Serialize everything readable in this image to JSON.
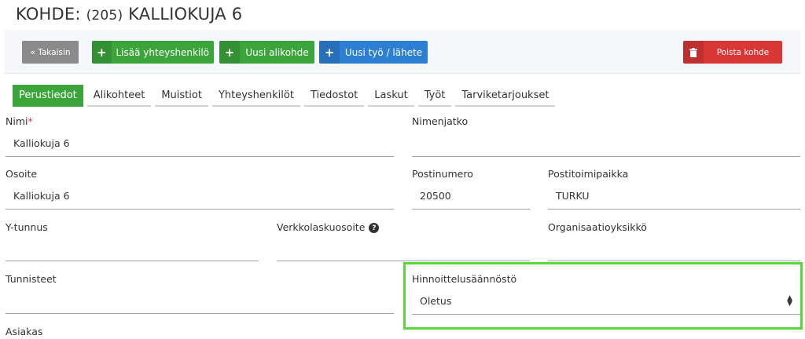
{
  "header": {
    "title_prefix": "KOHDE:",
    "title_code": "(205)",
    "title_name": "KALLIOKUJA 6"
  },
  "toolbar": {
    "back_label": "Takaisin",
    "add_contact_label": "Lisää yhteyshenkilö",
    "new_subtarget_label": "Uusi alikohde",
    "new_job_label": "Uusi työ / lähete",
    "delete_label": "Poista kohde",
    "colors": {
      "green": "#3ba53b",
      "blue": "#2d7fd3",
      "red": "#d93636",
      "grey": "#8a8a8a"
    }
  },
  "tabs": [
    {
      "label": "Perustiedot",
      "active": true
    },
    {
      "label": "Alikohteet",
      "active": false
    },
    {
      "label": "Muistiot",
      "active": false
    },
    {
      "label": "Yhteyshenkilöt",
      "active": false
    },
    {
      "label": "Tiedostot",
      "active": false
    },
    {
      "label": "Laskut",
      "active": false
    },
    {
      "label": "Työt",
      "active": false
    },
    {
      "label": "Tarviketarjoukset",
      "active": false
    }
  ],
  "form": {
    "name": {
      "label": "Nimi",
      "required_mark": "*",
      "value": "Kalliokuja 6"
    },
    "name_ext": {
      "label": "Nimenjatko",
      "value": ""
    },
    "address": {
      "label": "Osoite",
      "value": "Kalliokuja 6"
    },
    "postal_code": {
      "label": "Postinumero",
      "value": "20500"
    },
    "city": {
      "label": "Postitoimipaikka",
      "value": "TURKU"
    },
    "business_id": {
      "label": "Y-tunnus",
      "value": ""
    },
    "e_invoice": {
      "label": "Verkkolaskuosoite",
      "value": ""
    },
    "org_unit": {
      "label": "Organisaatioyksikkö",
      "value": ""
    },
    "tags": {
      "label": "Tunnisteet",
      "value": ""
    },
    "pricing_rules": {
      "label": "Hinnoittelusäännöstö",
      "value": "Oletus"
    },
    "customer": {
      "label": "Asiakas"
    }
  },
  "icons": {
    "back": "double-chevron-left-icon",
    "plus": "plus-icon",
    "trash": "trash-icon",
    "help": "question-circle-icon",
    "select": "sort-arrows-icon"
  },
  "highlight_color": "#58d838"
}
